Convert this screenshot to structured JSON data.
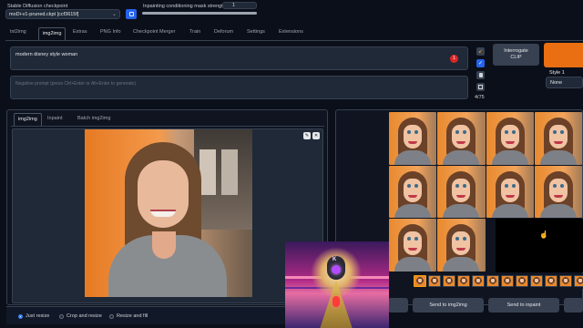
{
  "checkpoint": {
    "label": "Stable Diffusion checkpoint",
    "value": "moDi-v1-pruned.ckpt [ccf3615f]"
  },
  "mask_strength": {
    "label": "Inpainting conditioning mask strength",
    "value": "1",
    "fraction": 1.0
  },
  "main_tabs": [
    "txt2img",
    "img2img",
    "Extras",
    "PNG Info",
    "Checkpoint Merger",
    "Train",
    "Deforum",
    "Settings",
    "Extensions"
  ],
  "active_main_tab": "img2img",
  "prompt": {
    "value": "modern disney style woman",
    "token_badge": "1"
  },
  "negative_prompt": {
    "placeholder": "Negative prompt (press Ctrl+Enter or Alt+Enter to generate)"
  },
  "token_count": "4/75",
  "interrogate_button": "Interrogate CLIP",
  "style": {
    "label": "Style 1",
    "value": "None"
  },
  "sub_tabs": [
    "img2img",
    "Inpaint",
    "Batch img2img"
  ],
  "active_sub_tab": "img2img",
  "resize_modes": [
    "Just resize",
    "Crop and resize",
    "Resize and fill"
  ],
  "selected_resize_mode": "Just resize",
  "bottom_buttons": [
    "Send to img2img",
    "Send to inpaint"
  ],
  "colors": {
    "background": "#0b0f19",
    "generate_orange": "#ea6f12",
    "accent_blue": "#3b82f6",
    "badge_red": "#dc2626"
  }
}
